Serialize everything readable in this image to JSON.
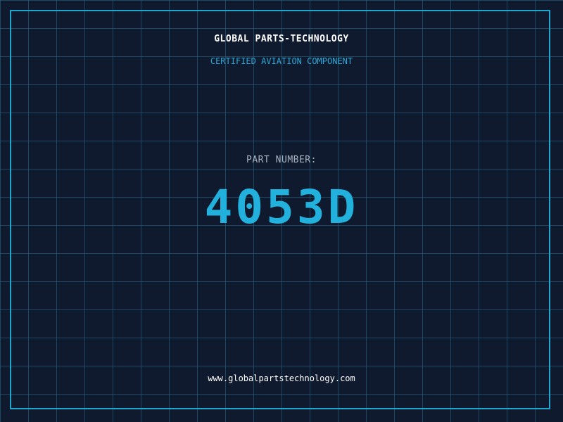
{
  "header": {
    "company": "GLOBAL PARTS-TECHNOLOGY",
    "tagline": "CERTIFIED AVIATION COMPONENT"
  },
  "part": {
    "label": "PART NUMBER:",
    "number": "4053D"
  },
  "footer": {
    "url": "www.globalpartstechnology.com"
  },
  "colors": {
    "background": "#101a2e",
    "grid": "#286e8c",
    "accent": "#1fa6cc",
    "text": "#ffffff",
    "label": "#a7b4c2"
  }
}
